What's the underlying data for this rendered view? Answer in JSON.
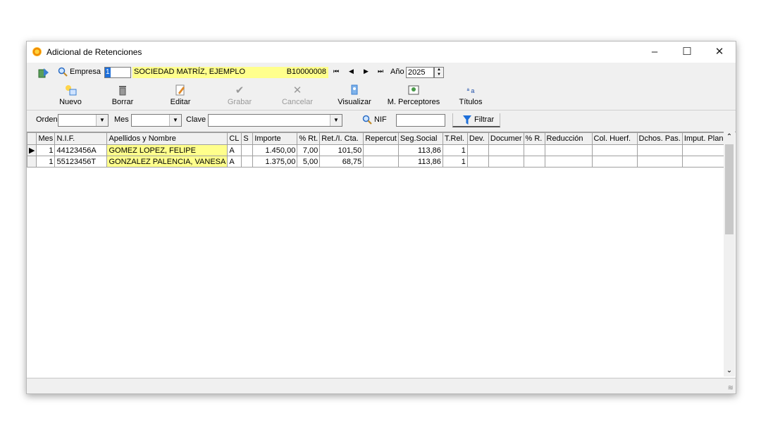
{
  "window": {
    "title": "Adicional de Retenciones"
  },
  "toolbar1": {
    "empresa_label": "Empresa",
    "empresa_code": "1",
    "empresa_name": "SOCIEDAD MATRÍZ, EJEMPLO",
    "empresa_cif": "B10000008",
    "nav": [
      "⏮",
      "◀",
      "▶",
      "⏭"
    ],
    "anio_label": "Año",
    "anio_value": "2025"
  },
  "toolbar2": {
    "nuevo": "Nuevo",
    "borrar": "Borrar",
    "editar": "Editar",
    "grabar": "Grabar",
    "cancelar": "Cancelar",
    "visualizar": "Visualizar",
    "perceptores": "M. Perceptores",
    "titulos": "Títulos"
  },
  "filters": {
    "orden_label": "Orden",
    "mes_label": "Mes",
    "clave_label": "Clave",
    "nif_label": "NIF",
    "filtrar": "Filtrar"
  },
  "grid": {
    "columns": [
      "Mes",
      "N.I.F.",
      "Apellidos y Nombre",
      "CL",
      "S",
      "Importe",
      "% Rt.",
      "Ret./I. Cta.",
      "Repercut",
      "Seg.Social",
      "T.Rel.",
      "Dev.",
      "Documer",
      "% R.",
      "Reducción",
      "Col. Huerf.",
      "Dchos. Pas.",
      "Imput. Planes"
    ],
    "rows": [
      [
        "1",
        "44123456A",
        "GOMEZ LOPEZ, FELIPE",
        "A",
        "",
        "1.450,00",
        "7,00",
        "101,50",
        "",
        "113,86",
        "1",
        "",
        "",
        "",
        "",
        "",
        "",
        ""
      ],
      [
        "1",
        "55123456T",
        "GONZALEZ PALENCIA, VANESA",
        "A",
        "",
        "1.375,00",
        "5,00",
        "68,75",
        "",
        "113,86",
        "1",
        "",
        "",
        "",
        "",
        "",
        "",
        ""
      ]
    ]
  },
  "colors": {
    "highlight": "#ffff8c",
    "accent": "#1e6fd9"
  }
}
